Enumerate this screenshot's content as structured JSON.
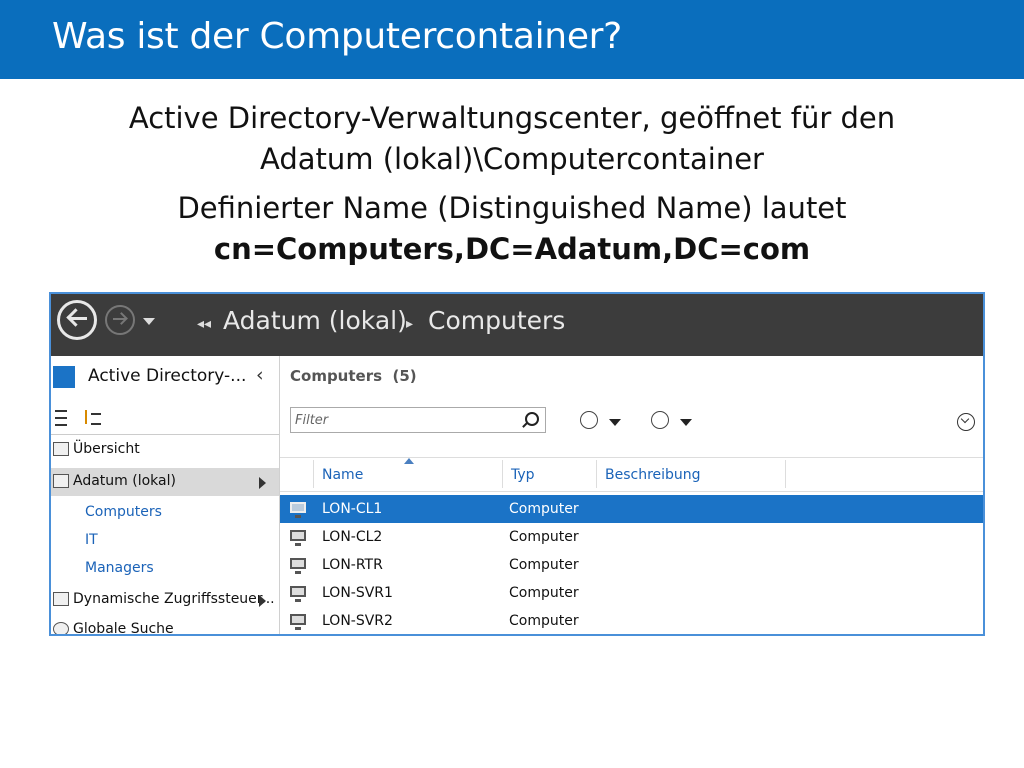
{
  "slide": {
    "title": "Was ist der Computercontainer?",
    "bullet1_line1": "Active Directory-Verwaltungscenter, geöffnet für den",
    "bullet1_line2": "Adatum (lokal)\\Computercontainer",
    "bullet2_line1": "Definierter Name (Distinguished Name) lautet",
    "bullet2_line2": "cn=Computers,DC=Adatum,DC=com"
  },
  "window": {
    "breadcrumb": [
      "Adatum (lokal)",
      "Computers"
    ],
    "sidebar": {
      "header": "Active Directory-...",
      "items": [
        {
          "label": "Übersicht",
          "has_arrow": false
        },
        {
          "label": "Adatum (lokal)",
          "has_arrow": true,
          "selected": true
        }
      ],
      "subitems": [
        "Computers",
        "IT",
        "Managers"
      ],
      "items2": [
        {
          "label": "Dynamische Zugriffssteuer...",
          "has_arrow": true
        },
        {
          "label": "Globale Suche",
          "has_arrow": false
        }
      ]
    },
    "content": {
      "heading": "Computers",
      "count": "(5)",
      "filter_placeholder": "Filter",
      "columns": [
        "Name",
        "Typ",
        "Beschreibung"
      ],
      "rows": [
        {
          "name": "LON-CL1",
          "type": "Computer",
          "selected": true
        },
        {
          "name": "LON-CL2",
          "type": "Computer"
        },
        {
          "name": "LON-RTR",
          "type": "Computer"
        },
        {
          "name": "LON-SVR1",
          "type": "Computer"
        },
        {
          "name": "LON-SVR2",
          "type": "Computer"
        }
      ]
    }
  },
  "colors": {
    "title_bar": "#0a6ebd",
    "selection": "#1b73c6",
    "nav_bar": "#3c3c3c"
  }
}
